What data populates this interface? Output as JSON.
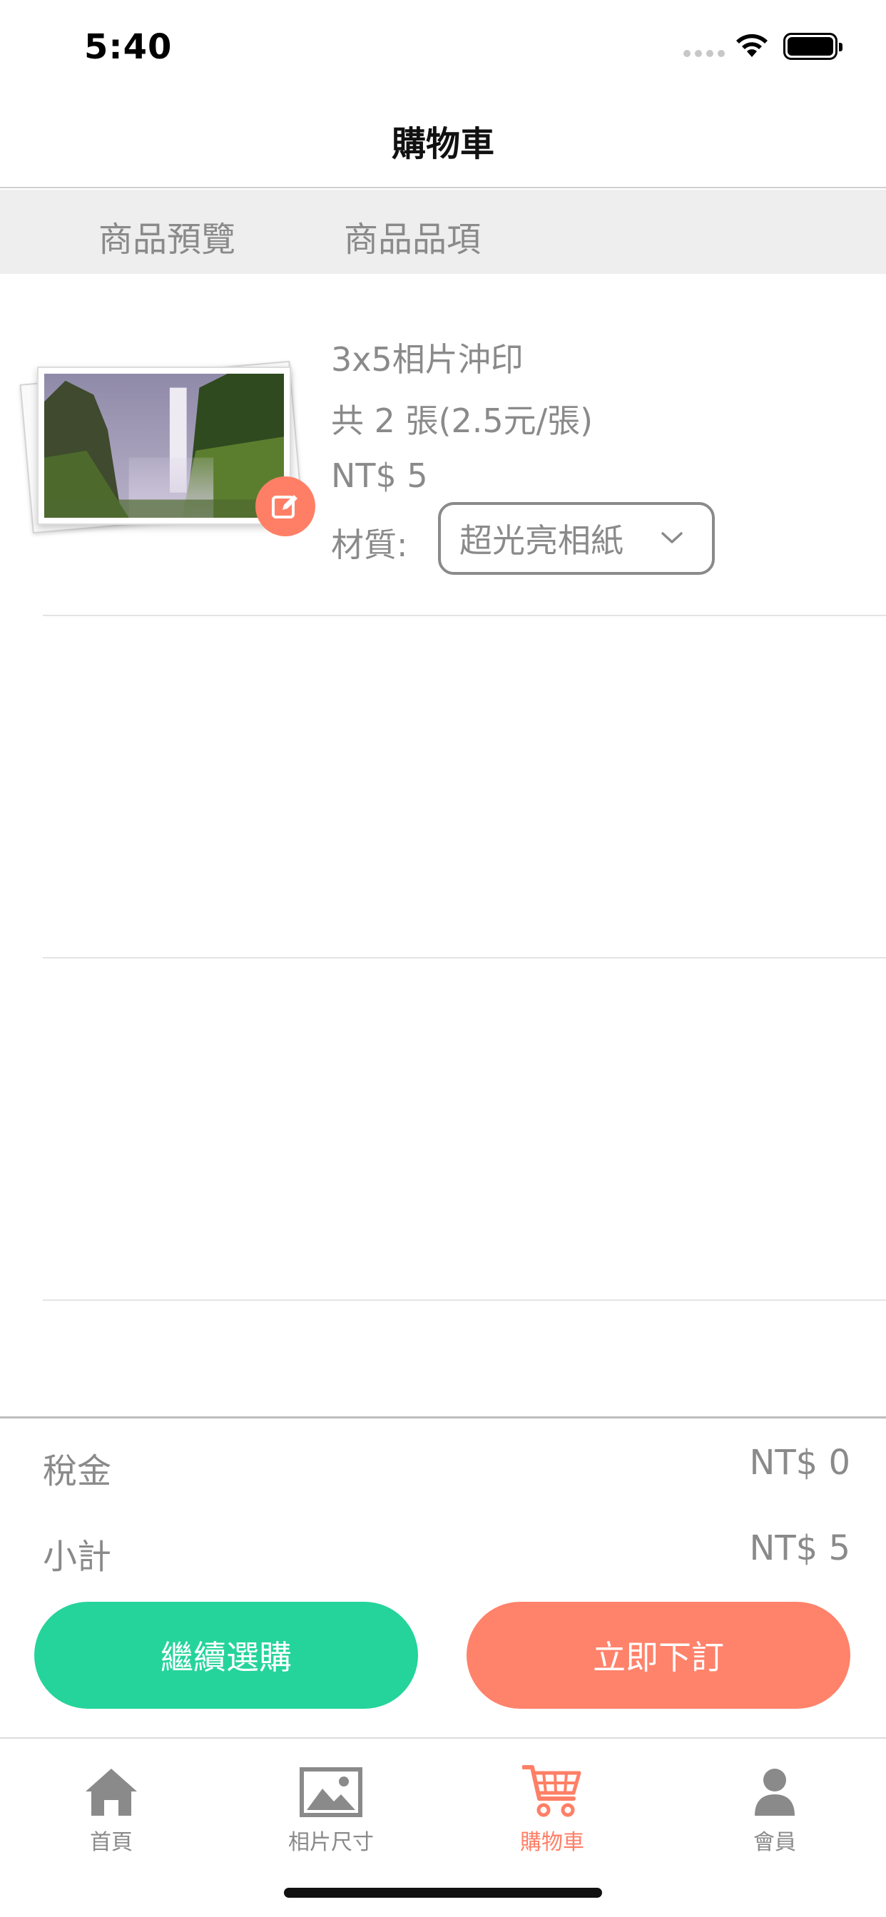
{
  "status_bar": {
    "time": "5:40"
  },
  "nav": {
    "title": "購物車"
  },
  "tabs": [
    {
      "label": "商品預覽"
    },
    {
      "label": "商品品項"
    }
  ],
  "cart_items": [
    {
      "title": "3x5相片沖印",
      "quantity": "共 2 張(2.5元/張)",
      "price": "NT$ 5",
      "material_label": "材質:",
      "material_value": "超光亮相紙"
    }
  ],
  "totals": {
    "tax_label": "稅金",
    "tax_value": "NT$ 0",
    "subtotal_label": "小計",
    "subtotal_value": "NT$ 5"
  },
  "buttons": {
    "continue_label": "繼續選購",
    "order_label": "立即下訂"
  },
  "tab_bar": [
    {
      "label": "首頁",
      "icon": "home-icon"
    },
    {
      "label": "相片尺寸",
      "icon": "image-icon"
    },
    {
      "label": "購物車",
      "icon": "cart-icon",
      "active": true
    },
    {
      "label": "會員",
      "icon": "person-icon"
    }
  ],
  "colors": {
    "accent": "#ff7f66",
    "green": "#25d49a",
    "text_gray": "#8a8a8a"
  }
}
